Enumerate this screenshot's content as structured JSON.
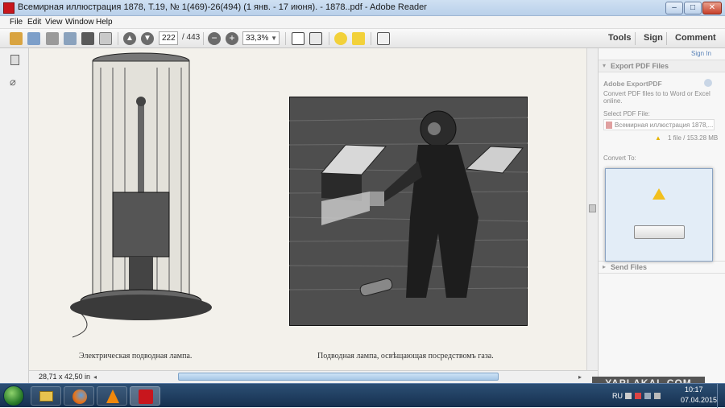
{
  "window": {
    "title": "Всемирная иллюстрация 1878, Т.19, № 1(469)-26(494) (1 янв. - 17 июня). - 1878..pdf - Adobe Reader",
    "controls": [
      "minimize",
      "maximize",
      "close"
    ]
  },
  "menu": [
    "File",
    "Edit",
    "View",
    "Window",
    "Help"
  ],
  "toolbar": {
    "current_page": "222",
    "page_total": "/ 443",
    "zoom": "33,3%",
    "tools_label": "Tools",
    "sign_label": "Sign",
    "comment_label": "Comment"
  },
  "right_pane": {
    "sign_in": "Sign In",
    "export_header": "Export PDF Files",
    "adobe_exportpdf": "Adobe ExportPDF",
    "desc_line1": "Convert PDF files to to Word or Excel",
    "desc_line2": "online.",
    "select_label": "Select PDF File:",
    "file_name": "Всемирная иллюстрация 1878,...",
    "file_size": "1 file / 153.28 MB",
    "convert_to": "Convert To:",
    "send_files": "Send Files"
  },
  "document": {
    "caption_left": "Электрическая подводная лампа.",
    "caption_right": "Подводная лампа, освѣщающая посредствомъ газа."
  },
  "status": {
    "page_size": "28,71 x 42,50 in"
  },
  "watermark": "YAPLAKAL.COM",
  "taskbar": {
    "apps": [
      "explorer",
      "firefox",
      "vlc",
      "adobe-reader"
    ],
    "lang": "RU",
    "time": "10:17",
    "date": "07.04.2015"
  },
  "colors": {
    "accent": "#c8161d",
    "panel_blue": "#1f5fa8",
    "taskbar": "#1d3a5c"
  }
}
